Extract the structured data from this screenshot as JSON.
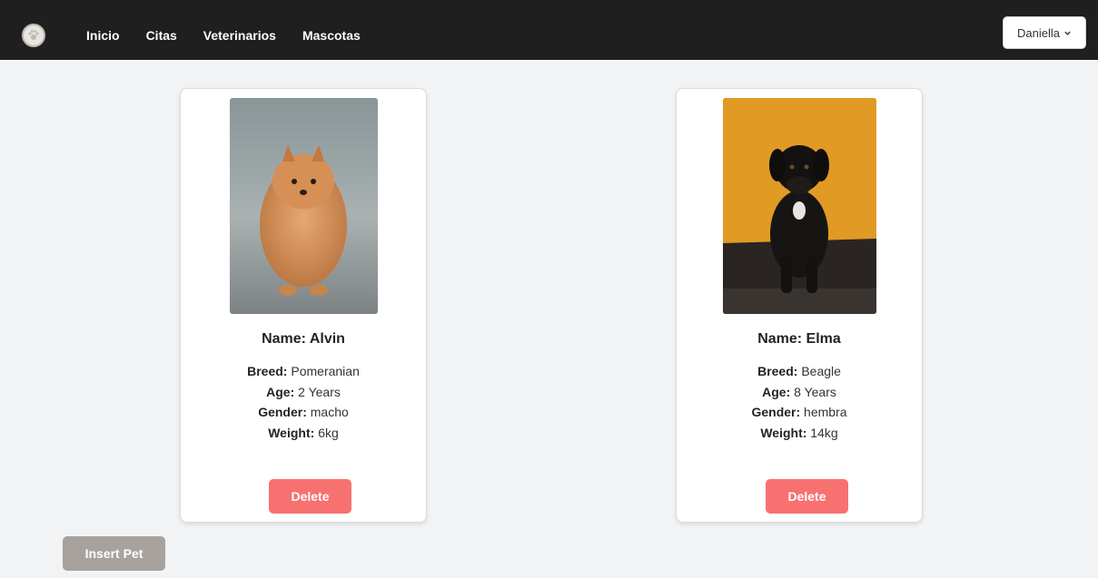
{
  "nav": {
    "logo_icon": "paw-logo-icon",
    "links": [
      "Inicio",
      "Citas",
      "Veterinarios",
      "Mascotas"
    ],
    "user_label": "Daniella",
    "user_menu_icon": "chevron-down-icon"
  },
  "pets": [
    {
      "name_label": "Name: Alvin",
      "breed_label": "Breed:",
      "breed": "Pomeranian",
      "age_label": "Age:",
      "age": "2 Years",
      "gender_label": "Gender:",
      "gender": "macho",
      "weight_label": "Weight:",
      "weight": "6kg",
      "delete_label": "Delete"
    },
    {
      "name_label": "Name: Elma",
      "breed_label": "Breed:",
      "breed": "Beagle",
      "age_label": "Age:",
      "age": "8 Years",
      "gender_label": "Gender:",
      "gender": "hembra",
      "weight_label": "Weight:",
      "weight": "14kg",
      "delete_label": "Delete"
    }
  ],
  "insert_label": "Insert Pet",
  "colors": {
    "navbar": "#1f1f1f",
    "delete": "#f87171",
    "insert": "#a8a29e",
    "background": "#f2f3f5"
  }
}
